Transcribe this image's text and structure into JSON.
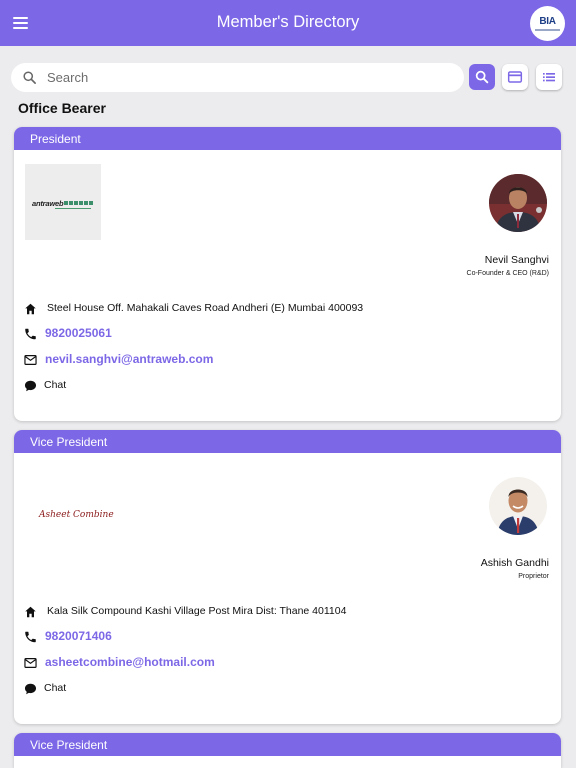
{
  "app": {
    "title": "Member's Directory",
    "logo_text": "BIA"
  },
  "search": {
    "placeholder": "Search",
    "value": ""
  },
  "toolbar": {
    "buttons": [
      "search-icon",
      "card-view-icon",
      "list-view-icon"
    ],
    "accent_color": "#7c68e6"
  },
  "section": {
    "title": "Office Bearer"
  },
  "members": [
    {
      "designation": "President",
      "company_logo": "antraweb",
      "name": "Nevil Sanghvi",
      "role": "Co-Founder & CEO (R&D)",
      "address": "Steel House Off. Mahakali Caves Road Andheri  (E) Mumbai  400093",
      "phone": "9820025061",
      "email": "nevil.sanghvi@antraweb.com",
      "chat_label": "Chat"
    },
    {
      "designation": "Vice President",
      "company_logo": "Asheet Combine",
      "name": "Ashish Gandhi",
      "role": "Proprietor",
      "address": "Kala Silk Compound Kashi Village Post Mira Dist: Thane  401104",
      "phone": "9820071406",
      "email": "asheetcombine@hotmail.com",
      "chat_label": "Chat"
    },
    {
      "designation": "Vice President"
    }
  ]
}
